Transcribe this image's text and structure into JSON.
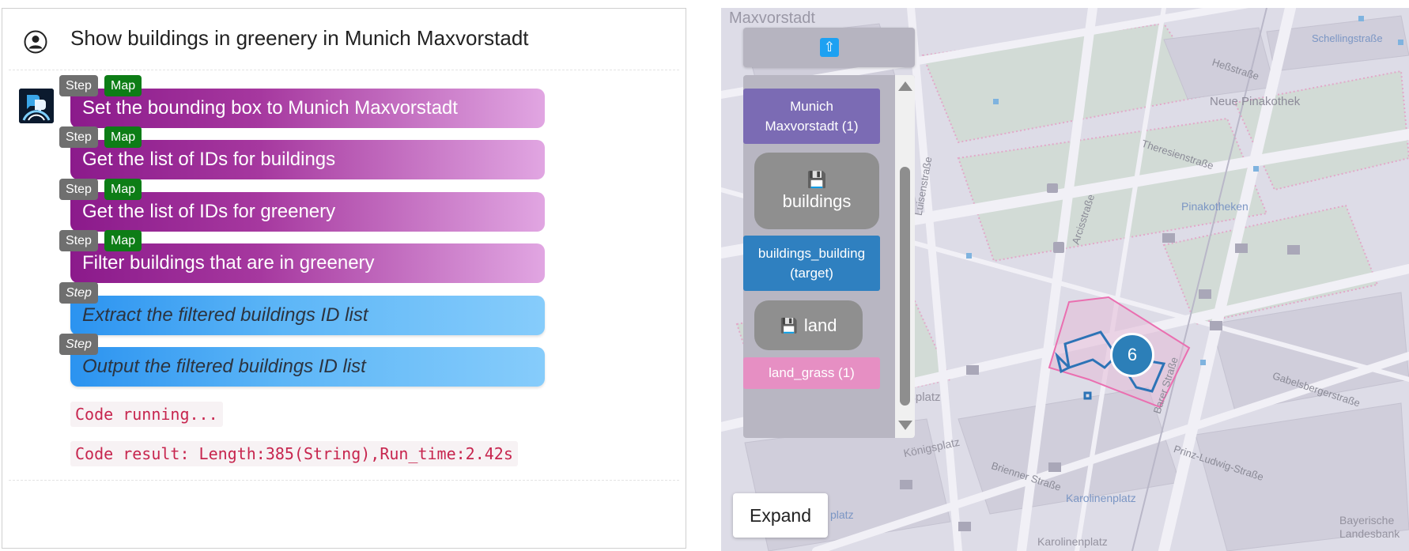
{
  "chat": {
    "query": "Show buildings in greenery in Munich Maxvorstadt",
    "steps": [
      {
        "badge": "Step",
        "map_badge": "Map",
        "text": "Set the bounding box to Munich Maxvorstadt"
      },
      {
        "badge": "Step",
        "map_badge": "Map",
        "text": "Get the list of IDs for buildings"
      },
      {
        "badge": "Step",
        "map_badge": "Map",
        "text": "Get the list of IDs for greenery"
      },
      {
        "badge": "Step",
        "map_badge": "Map",
        "text": "Filter buildings that are in greenery"
      },
      {
        "badge": "Step",
        "text": "Extract the filtered buildings ID list"
      },
      {
        "badge": "Step",
        "text": "Output the filtered buildings ID list"
      }
    ],
    "code_running": "Code running...",
    "code_result": "Code result: Length:385(String),Run_time:2.42s"
  },
  "map": {
    "layers": [
      {
        "label": "Munich Maxvorstadt (1)",
        "color": "#7b6bb4"
      },
      {
        "label": "buildings",
        "icon": "floppy-disk-icon",
        "color": "#8f8f8f"
      },
      {
        "label": "buildings_building (target)",
        "color": "#2f80c0"
      },
      {
        "label": "land",
        "icon": "floppy-disk-icon",
        "color": "#8f8f8f"
      },
      {
        "label": "land_grass (1)",
        "color": "#e68fc3"
      }
    ],
    "expand_label": "Expand",
    "cluster_count": "6",
    "labels": {
      "district": "Maxvorstadt",
      "neue_pinakothek": "Neue Pinakothek",
      "pinakotheken": "Pinakotheken",
      "koenigsplatz": "Königsplatz",
      "koenigsplatz_street": "Königsplatz",
      "karolinenplatz": "Karolinenplatz",
      "karolinenplatz_bottom": "Karolinenplatz",
      "bayerische": "Bayerische",
      "landesbank": "Landesbank",
      "schellingstrasse": "Schellingstraße",
      "hessstrasse": "Heßstraße",
      "theresienstrasse": "Theresienstraße",
      "gabelsbergerstrasse": "Gabelsbergerstraße",
      "brienner_strasse": "Brienner Straße",
      "prinz_ludwig_strasse": "Prinz-Ludwig-Straße",
      "arcisstrasse": "Arcisstraße",
      "luisenstrasse": "Luisenstraße",
      "barer_strasse": "Barer Straße",
      "platz": "platz"
    }
  }
}
